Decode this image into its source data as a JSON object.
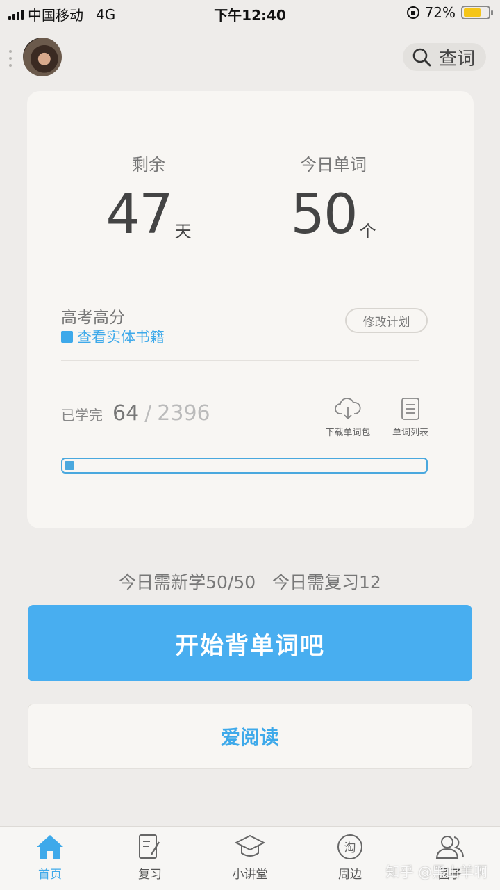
{
  "status_bar": {
    "carrier": "中国移动",
    "network": "4G",
    "time": "下午12:40",
    "battery": "72%",
    "battery_level": 0.72
  },
  "header": {
    "search_label": "查词"
  },
  "card": {
    "remaining": {
      "label": "剩余",
      "value": "47",
      "unit": "天"
    },
    "today_words": {
      "label": "今日单词",
      "value": "50",
      "unit": "个"
    },
    "plan_name": "高考高分",
    "book_link": "查看实体书籍",
    "edit_plan": "修改计划",
    "learned_label": "已学完",
    "learned_count": "64",
    "separator": "/",
    "total_count": "2396",
    "progress_fraction": 0.0267,
    "tools": {
      "download": "下载单词包",
      "word_list": "单词列表"
    }
  },
  "daily_summary": "今日需新学50/50   今日需复习12",
  "start_button": "开始背单词吧",
  "reading_button": "爱阅读",
  "tabs": [
    {
      "label": "首页",
      "icon": "home-icon",
      "active": true
    },
    {
      "label": "复习",
      "icon": "review-icon",
      "active": false
    },
    {
      "label": "小讲堂",
      "icon": "graduation-cap-icon",
      "active": false
    },
    {
      "label": "周边",
      "icon": "taobao-icon",
      "active": false
    },
    {
      "label": "圈子",
      "icon": "users-icon",
      "active": false
    }
  ],
  "watermark": "知乎 @黑山羊啊",
  "colors": {
    "accent": "#48aef0",
    "link": "#3ea9ea",
    "background": "#eeecea",
    "card": "#f8f6f3"
  }
}
